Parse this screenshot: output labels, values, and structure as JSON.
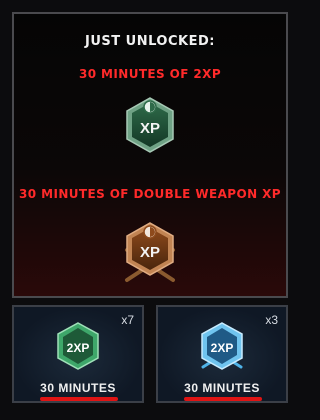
{
  "header": {
    "title": "JUST UNLOCKED:"
  },
  "rewards": [
    {
      "label": "30 MINUTES OF 2XP",
      "icon": "xp-token-icon"
    },
    {
      "label": "30 MINUTES OF DOUBLE WEAPON XP",
      "icon": "weapon-xp-token-icon"
    }
  ],
  "inventory": [
    {
      "count": "x7",
      "token_label": "2XP",
      "duration": "30 MINUTES",
      "icon": "2xp-token-icon"
    },
    {
      "count": "x3",
      "token_label": "2XP",
      "duration": "30 MINUTES",
      "icon": "2xp-weapon-token-icon"
    }
  ],
  "colors": {
    "accent_red": "#ff2a2a",
    "xp_green": "#3ea76a",
    "weapon_orange": "#d1732a",
    "weapon_blue": "#4fb3e8"
  }
}
